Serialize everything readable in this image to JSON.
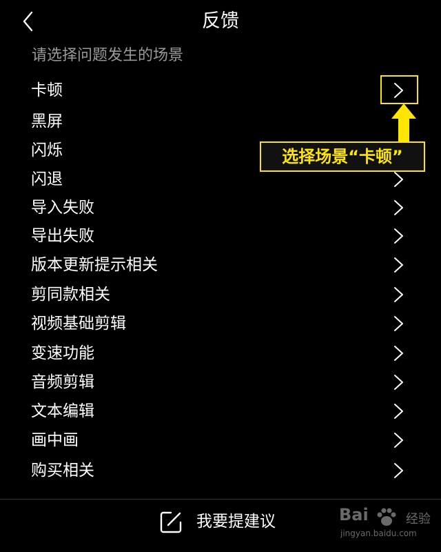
{
  "header": {
    "title": "反馈",
    "back_icon": "chevron-left-icon"
  },
  "subtitle": "请选择问题发生的场景",
  "items": [
    {
      "label": "卡顿"
    },
    {
      "label": "黑屏"
    },
    {
      "label": "闪烁"
    },
    {
      "label": "闪退"
    },
    {
      "label": "导入失败"
    },
    {
      "label": "导出失败"
    },
    {
      "label": "版本更新提示相关"
    },
    {
      "label": "剪同款相关"
    },
    {
      "label": "视频基础剪辑"
    },
    {
      "label": "变速功能"
    },
    {
      "label": "音频剪辑"
    },
    {
      "label": "文本编辑"
    },
    {
      "label": "画中画"
    },
    {
      "label": "购买相关"
    }
  ],
  "annotation": {
    "text": "选择场景“卡顿”",
    "color": "#ffe600"
  },
  "footer": {
    "button_label": "我要提建议",
    "icon": "edit-icon"
  },
  "watermark": {
    "brand": "Bai",
    "text": "经验",
    "url": "jingyan.baidu.com"
  }
}
